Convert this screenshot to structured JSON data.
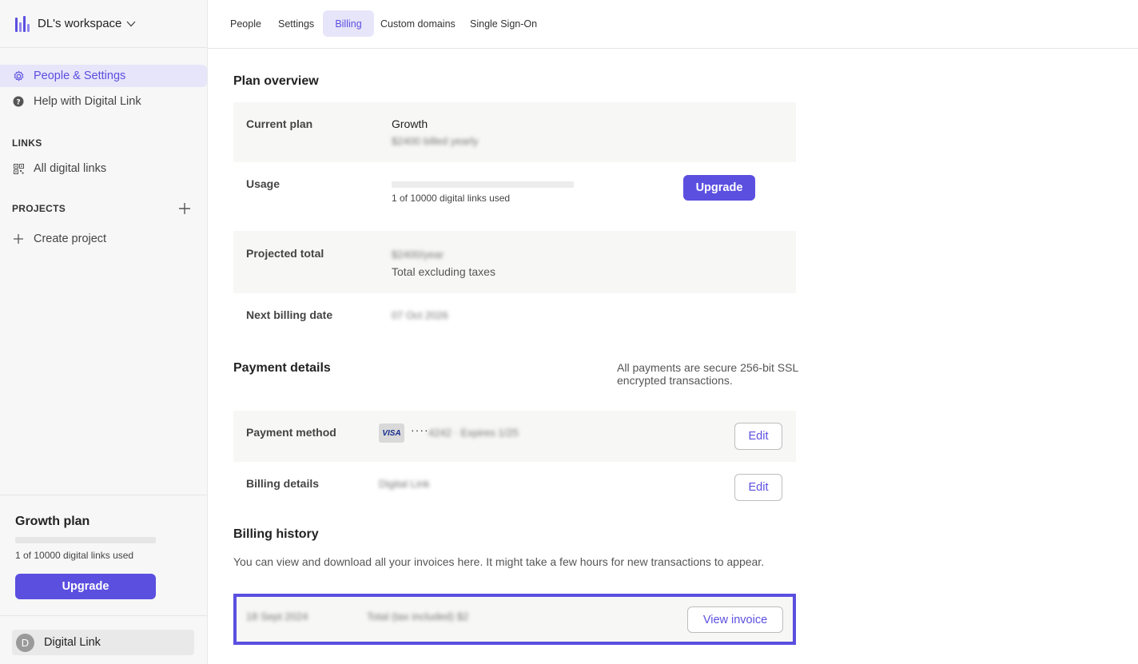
{
  "workspace": {
    "name": "DL's workspace"
  },
  "sidebar": {
    "items": [
      {
        "label": "People & Settings",
        "icon": "gear-icon"
      },
      {
        "label": "Help with Digital Link",
        "icon": "help-circle-icon"
      }
    ],
    "links_section": "LINKS",
    "links_items": [
      {
        "label": "All digital links",
        "icon": "qr-code-icon"
      }
    ],
    "projects_section": "PROJECTS",
    "project_items": [
      {
        "label": "Create project",
        "icon": "plus-icon"
      }
    ]
  },
  "plan_box": {
    "title": "Growth plan",
    "usage": "1 of 10000 digital links used",
    "usage_fraction": 0.0001,
    "upgrade_label": "Upgrade"
  },
  "user": {
    "initial": "D",
    "name": "Digital Link"
  },
  "tabs": [
    {
      "label": "People"
    },
    {
      "label": "Settings"
    },
    {
      "label": "Billing",
      "active": true
    },
    {
      "label": "Custom domains"
    },
    {
      "label": "Single Sign-On"
    }
  ],
  "plan_overview": {
    "heading": "Plan overview",
    "current_plan_label": "Current plan",
    "current_plan_value": "Growth",
    "current_plan_sub": "$2400 billed yearly",
    "usage_label": "Usage",
    "usage_text": "1 of 10000 digital links used",
    "usage_fraction": 0.0001,
    "upgrade_label": "Upgrade",
    "projected_label": "Projected total",
    "projected_value": "$2400/year",
    "projected_sub": "Total excluding taxes",
    "next_billing_label": "Next billing date",
    "next_billing_value": "07 Oct 2026"
  },
  "payment": {
    "heading": "Payment details",
    "secure_note": "All payments are secure 256-bit SSL encrypted transactions.",
    "method_label": "Payment method",
    "card_brand": "VISA",
    "card_mask": "····",
    "card_info": "4242 · Expires 1/25",
    "edit_label": "Edit",
    "billing_details_label": "Billing details",
    "billing_details_value": "Digital Link"
  },
  "history": {
    "heading": "Billing history",
    "description": "You can view and download all your invoices here. It might take a few hours for new transactions to appear.",
    "rows": [
      {
        "date": "18 Sept 2024",
        "total": "Total (tax included) $2",
        "action": "View invoice"
      }
    ]
  },
  "colors": {
    "accent": "#5b4fe0",
    "accent_soft": "#e7e5f9",
    "highlight_border": "#5b4fe0"
  }
}
